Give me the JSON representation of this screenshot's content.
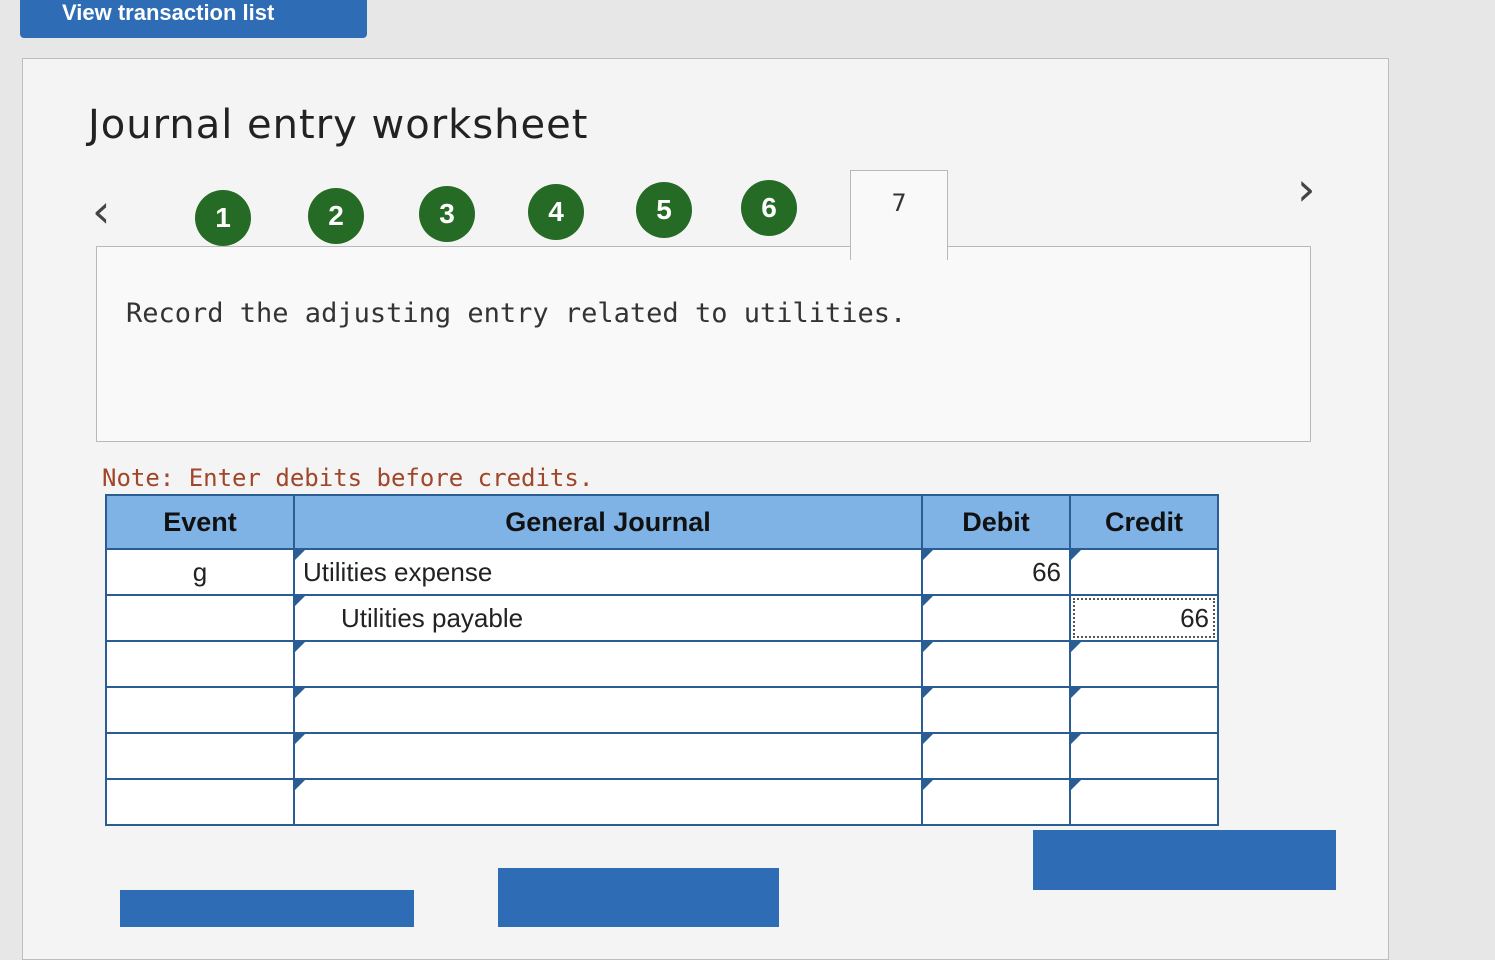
{
  "top_button": {
    "label": "View transaction list"
  },
  "worksheet": {
    "title": "Journal entry worksheet"
  },
  "steps": [
    "1",
    "2",
    "3",
    "4",
    "5",
    "6"
  ],
  "active_tab": "7",
  "instruction": "Record the adjusting entry related to utilities.",
  "note": "Note: Enter debits before credits.",
  "table": {
    "headers": {
      "event": "Event",
      "journal": "General Journal",
      "debit": "Debit",
      "credit": "Credit"
    },
    "rows": [
      {
        "event": "g",
        "account": "Utilities expense",
        "debit": "66",
        "credit": ""
      },
      {
        "event": "",
        "account": "Utilities payable",
        "debit": "",
        "credit": "66"
      },
      {
        "event": "",
        "account": "",
        "debit": "",
        "credit": ""
      },
      {
        "event": "",
        "account": "",
        "debit": "",
        "credit": ""
      },
      {
        "event": "",
        "account": "",
        "debit": "",
        "credit": ""
      },
      {
        "event": "",
        "account": "",
        "debit": "",
        "credit": ""
      }
    ]
  },
  "colors": {
    "accent": "#2e6db5",
    "step_green": "#256b25",
    "header_blue": "#7fb2e5",
    "note": "#a0462a"
  }
}
